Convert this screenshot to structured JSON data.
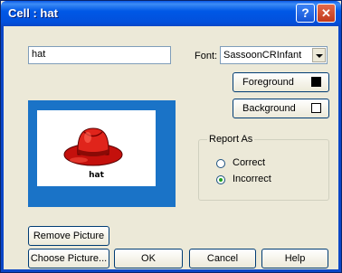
{
  "window": {
    "title": "Cell : hat",
    "help_glyph": "?",
    "close_glyph": "✕"
  },
  "cell_text": "hat",
  "font": {
    "label": "Font:",
    "value": "SassoonCRInfant"
  },
  "buttons": {
    "foreground": "Foreground",
    "background": "Background",
    "remove_picture": "Remove Picture",
    "choose_picture": "Choose Picture...",
    "ok": "OK",
    "cancel": "Cancel",
    "help": "Help"
  },
  "swatches": {
    "foreground": "#000000",
    "background": "#ffffff"
  },
  "picture": {
    "caption": "hat",
    "icon": "red-hat-icon",
    "frame_color": "#1a73c7"
  },
  "report_as": {
    "legend": "Report As",
    "options": [
      {
        "label": "Correct",
        "selected": false
      },
      {
        "label": "Incorrect",
        "selected": true
      }
    ]
  }
}
